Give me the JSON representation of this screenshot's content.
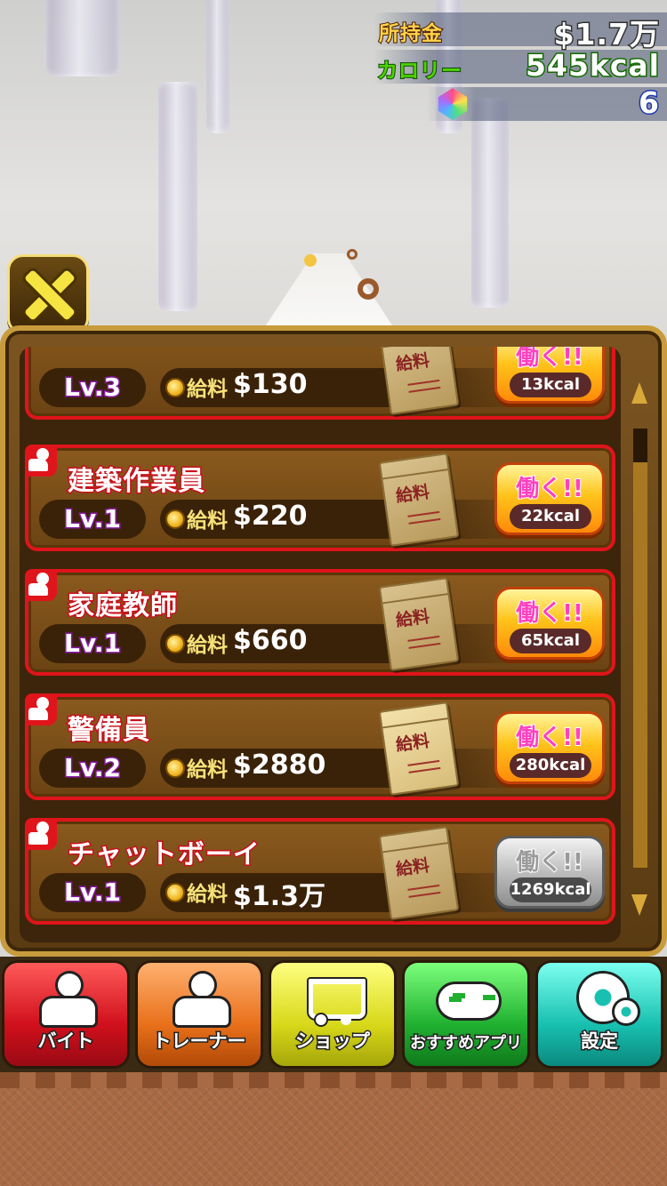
{
  "hud": {
    "money_label": "所持金",
    "money_value": "$1.7万",
    "calorie_label": "カロリー",
    "calorie_value": "545kcal",
    "gem_value": "6"
  },
  "jobs": [
    {
      "name": "",
      "level": "Lv.3",
      "salary_label": "給料",
      "salary": "$130",
      "envelope_text": "給料",
      "work_label": "働く!!",
      "kcal": "13kcal",
      "enabled": true
    },
    {
      "name": "建築作業員",
      "level": "Lv.1",
      "salary_label": "給料",
      "salary": "$220",
      "envelope_text": "給料",
      "work_label": "働く!!",
      "kcal": "22kcal",
      "enabled": true
    },
    {
      "name": "家庭教師",
      "level": "Lv.1",
      "salary_label": "給料",
      "salary": "$660",
      "envelope_text": "給料",
      "work_label": "働く!!",
      "kcal": "65kcal",
      "enabled": true
    },
    {
      "name": "警備員",
      "level": "Lv.2",
      "salary_label": "給料",
      "salary": "$2880",
      "envelope_text": "給料",
      "work_label": "働く!!",
      "kcal": "280kcal",
      "enabled": true
    },
    {
      "name": "チャットボーイ",
      "level": "Lv.1",
      "salary_label": "給料",
      "salary": "$1.3万",
      "envelope_text": "給料",
      "work_label": "働く!!",
      "kcal": "1269kcal",
      "enabled": false
    }
  ],
  "nav": {
    "baito": "バイト",
    "trainer": "トレーナー",
    "shop": "ショップ",
    "apps": "おすすめアプリ",
    "settings": "設定"
  },
  "colors": {
    "job_border": "#e0141b",
    "panel_frame": "#c89c3c",
    "calorie_label": "#4cd400",
    "money_label": "#ffd24a"
  },
  "icons": [
    "close-icon",
    "gem-icon",
    "coin-icon",
    "envelope-icon",
    "job-person-icon",
    "person-icon",
    "muscle-icon",
    "cart-icon",
    "gamepad-icon",
    "gear-icon"
  ]
}
